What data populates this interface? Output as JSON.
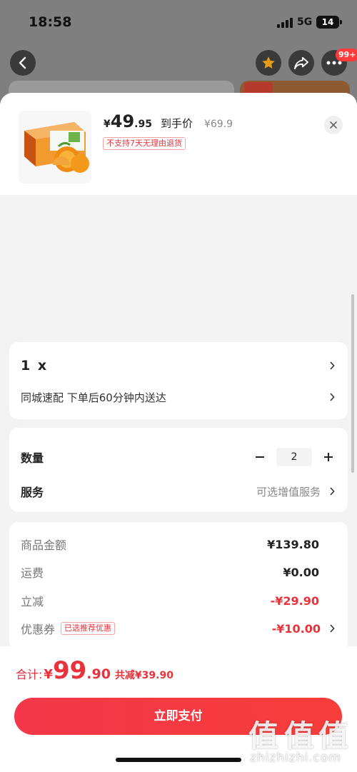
{
  "status_bar": {
    "time": "18:58",
    "network": "5G",
    "battery": "14"
  },
  "top_nav": {
    "cart_badge": "99+"
  },
  "product": {
    "currency": "¥",
    "price_int": "49",
    "price_dec": ".95",
    "price_label": "到手价",
    "original_price": "¥69.9",
    "return_tag": "不支持7天无理由退货"
  },
  "spec": {
    "quantity_text": "1 x",
    "delivery": "同城速配 下单后60分钟内送达"
  },
  "quantity": {
    "label": "数量",
    "value": "2"
  },
  "service": {
    "label": "服务",
    "value": "可选增值服务"
  },
  "costs": [
    {
      "label": "商品金额",
      "value": "¥139.80"
    },
    {
      "label": "运费",
      "value": "¥0.00"
    },
    {
      "label": "立减",
      "value": "-¥29.90"
    },
    {
      "label": "优惠券",
      "tag": "已选推荐优惠",
      "value": "-¥10.00"
    }
  ],
  "footer": {
    "total_label": "合计:",
    "total_currency": "¥",
    "total_int": "99",
    "total_dec": ".90",
    "saved": "共减¥39.90",
    "pay_button": "立即支付"
  },
  "watermark": {
    "glyph": "值",
    "site": "zhizhizhi.com"
  },
  "colors": {
    "accent": "#e8323c",
    "pay_button": "#f4374a"
  }
}
